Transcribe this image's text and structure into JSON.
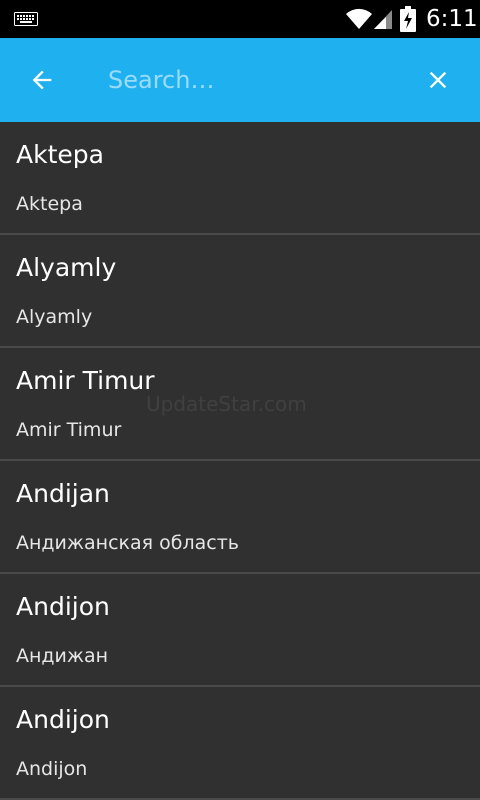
{
  "status_bar": {
    "time": "6:11",
    "icons": [
      "keyboard-icon",
      "wifi-icon",
      "signal-icon",
      "battery-charging-icon"
    ]
  },
  "toolbar": {
    "color": "#1fb0f0",
    "back_icon": "arrow-left-icon",
    "search_placeholder": "Search…",
    "search_value": "",
    "clear_icon": "close-icon"
  },
  "results": [
    {
      "title": "Aktepa",
      "subtitle": "Aktepa"
    },
    {
      "title": "Alyamly",
      "subtitle": "Alyamly"
    },
    {
      "title": "Amir Timur",
      "subtitle": "Amir Timur"
    },
    {
      "title": "Andijan",
      "subtitle": "Андижанская область"
    },
    {
      "title": "Andijon",
      "subtitle": "Андижан"
    },
    {
      "title": "Andijon",
      "subtitle": "Andijon"
    }
  ],
  "watermark": "UpdateStar.com",
  "colors": {
    "background": "#303030",
    "divider": "#4a4a4a",
    "accent": "#1fb0f0"
  }
}
